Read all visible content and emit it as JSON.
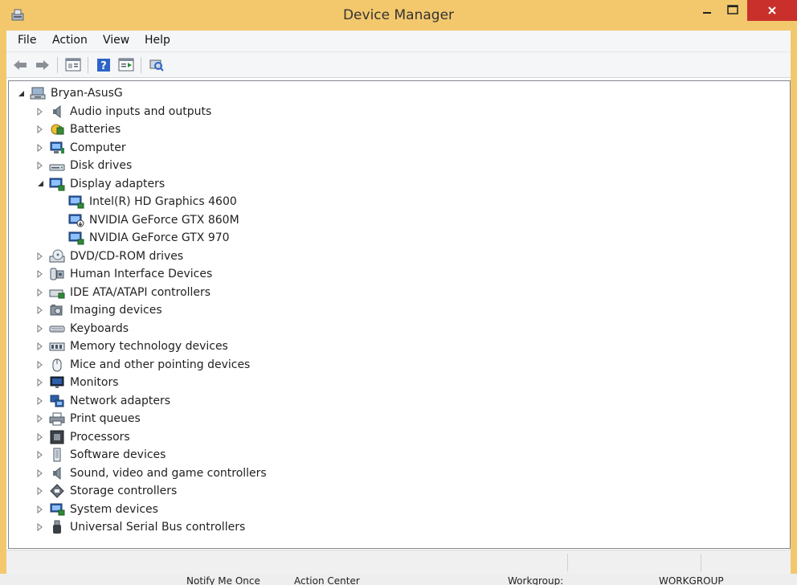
{
  "window": {
    "title": "Device Manager"
  },
  "menu": [
    "File",
    "Action",
    "View",
    "Help"
  ],
  "tree": {
    "root": "Bryan-AsusG",
    "categories": [
      {
        "label": "Audio inputs and outputs",
        "icon": "speaker-icon",
        "expanded": false
      },
      {
        "label": "Batteries",
        "icon": "battery-icon",
        "expanded": false
      },
      {
        "label": "Computer",
        "icon": "computer-icon",
        "expanded": false
      },
      {
        "label": "Disk drives",
        "icon": "disk-drive-icon",
        "expanded": false
      },
      {
        "label": "Display adapters",
        "icon": "display-adapter-icon",
        "expanded": true,
        "children": [
          "Intel(R) HD Graphics 4600",
          "NVIDIA GeForce GTX 860M",
          "NVIDIA GeForce GTX 970"
        ]
      },
      {
        "label": "DVD/CD-ROM drives",
        "icon": "dvd-drive-icon",
        "expanded": false
      },
      {
        "label": "Human Interface Devices",
        "icon": "hid-icon",
        "expanded": false
      },
      {
        "label": "IDE ATA/ATAPI controllers",
        "icon": "ide-controller-icon",
        "expanded": false
      },
      {
        "label": "Imaging devices",
        "icon": "camera-icon",
        "expanded": false
      },
      {
        "label": "Keyboards",
        "icon": "keyboard-icon",
        "expanded": false
      },
      {
        "label": "Memory technology devices",
        "icon": "memory-icon",
        "expanded": false
      },
      {
        "label": "Mice and other pointing devices",
        "icon": "mouse-icon",
        "expanded": false
      },
      {
        "label": "Monitors",
        "icon": "monitor-icon",
        "expanded": false
      },
      {
        "label": "Network adapters",
        "icon": "network-icon",
        "expanded": false
      },
      {
        "label": "Print queues",
        "icon": "printer-icon",
        "expanded": false
      },
      {
        "label": "Processors",
        "icon": "processor-icon",
        "expanded": false
      },
      {
        "label": "Software devices",
        "icon": "software-device-icon",
        "expanded": false
      },
      {
        "label": "Sound, video and game controllers",
        "icon": "speaker-icon",
        "expanded": false
      },
      {
        "label": "Storage controllers",
        "icon": "storage-controller-icon",
        "expanded": false
      },
      {
        "label": "System devices",
        "icon": "system-device-icon",
        "expanded": false
      },
      {
        "label": "Universal Serial Bus controllers",
        "icon": "usb-icon",
        "expanded": false
      }
    ]
  },
  "taskbar_strip": [
    "Notify Me Once",
    "Action Center",
    "Workgroup:",
    "WORKGROUP"
  ],
  "colors": {
    "titlebar": "#f3c86d",
    "close": "#c9302c",
    "client": "#ffffff",
    "tree_border": "#828790"
  }
}
